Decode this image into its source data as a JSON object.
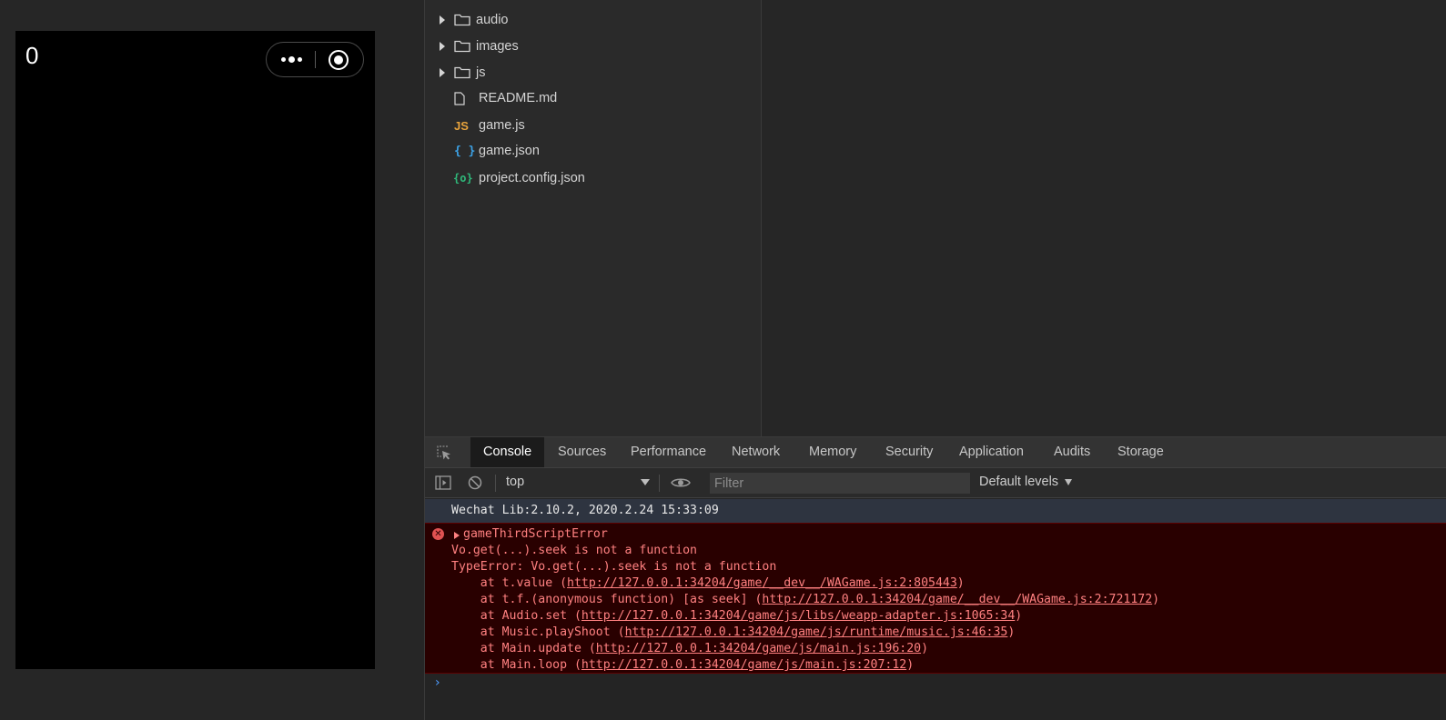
{
  "simulator": {
    "score": "0",
    "capsule": {
      "more_icon": "more-dots-icon",
      "close_icon": "target-close-icon"
    }
  },
  "file_tree": {
    "items": [
      {
        "label": "audio",
        "type": "folder",
        "icon": "folder-icon"
      },
      {
        "label": "images",
        "type": "folder",
        "icon": "folder-icon"
      },
      {
        "label": "js",
        "type": "folder",
        "icon": "folder-icon"
      },
      {
        "label": "README.md",
        "type": "file",
        "icon": "file-icon"
      },
      {
        "label": "game.js",
        "type": "file",
        "icon": "js-file-icon",
        "icon_text": "JS"
      },
      {
        "label": "game.json",
        "type": "file",
        "icon": "json-file-icon",
        "icon_text": "{ }"
      },
      {
        "label": "project.config.json",
        "type": "file",
        "icon": "config-file-icon",
        "icon_text": "{o}"
      }
    ]
  },
  "devtools": {
    "tabs": [
      {
        "label": "Console",
        "active": true
      },
      {
        "label": "Sources"
      },
      {
        "label": "Performance"
      },
      {
        "label": "Network"
      },
      {
        "label": "Memory"
      },
      {
        "label": "Security"
      },
      {
        "label": "Application"
      },
      {
        "label": "Audits"
      },
      {
        "label": "Storage"
      }
    ],
    "toolbar": {
      "context": "top",
      "filter_placeholder": "Filter",
      "levels": "Default levels"
    },
    "console": {
      "info": "Wechat Lib:2.10.2, 2020.2.24 15:33:09",
      "error": {
        "title": "gameThirdScriptError",
        "message": "Vo.get(...).seek is not a function",
        "type_line": "TypeError: Vo.get(...).seek is not a function",
        "stack": [
          {
            "pre": "    at t.value (",
            "url": "http://127.0.0.1:34204/game/__dev__/WAGame.js:2:805443",
            "post": ")"
          },
          {
            "pre": "    at t.f.(anonymous function) [as seek] (",
            "url": "http://127.0.0.1:34204/game/__dev__/WAGame.js:2:721172",
            "post": ")"
          },
          {
            "pre": "    at Audio.set (",
            "url": "http://127.0.0.1:34204/game/js/libs/weapp-adapter.js:1065:34",
            "post": ")"
          },
          {
            "pre": "    at Music.playShoot (",
            "url": "http://127.0.0.1:34204/game/js/runtime/music.js:46:35",
            "post": ")"
          },
          {
            "pre": "    at Main.update (",
            "url": "http://127.0.0.1:34204/game/js/main.js:196:20",
            "post": ")"
          },
          {
            "pre": "    at Main.loop (",
            "url": "http://127.0.0.1:34204/game/js/main.js:207:12",
            "post": ")"
          }
        ]
      },
      "prompt": "›"
    }
  }
}
